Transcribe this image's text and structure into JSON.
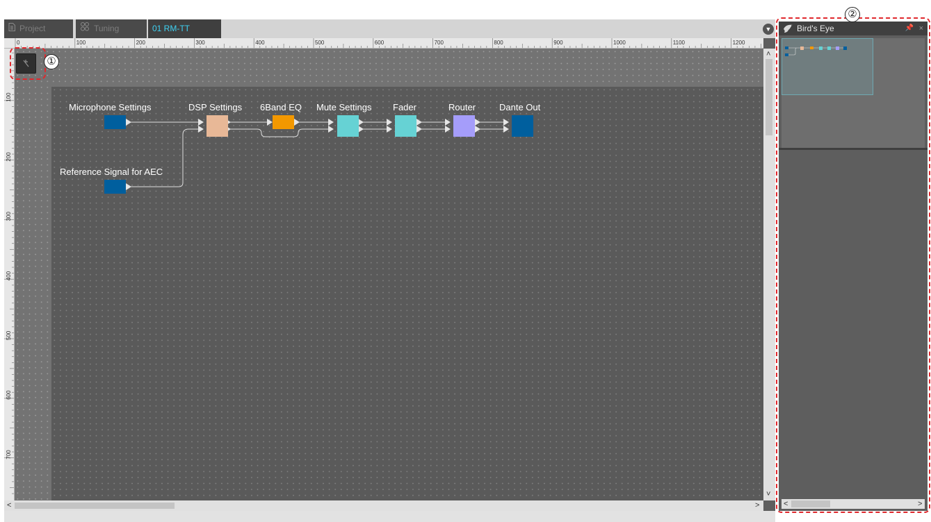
{
  "tabs": [
    {
      "label": "Project",
      "icon": "document-icon"
    },
    {
      "label": "Tuning",
      "icon": "sliders-icon"
    },
    {
      "label": "01 RM-TT",
      "icon": ""
    }
  ],
  "ruler": {
    "top_labels": [
      "0",
      "100",
      "200",
      "300",
      "400",
      "500",
      "600",
      "700",
      "800",
      "900",
      "1000",
      "1100",
      "1200"
    ],
    "left_labels": [
      "100",
      "200",
      "300",
      "400",
      "500",
      "600",
      "700"
    ]
  },
  "blocks": {
    "mic": {
      "label": "Microphone Settings",
      "color": "#005f9e"
    },
    "ref": {
      "label": "Reference Signal for AEC",
      "color": "#005f9e"
    },
    "dsp": {
      "label": "DSP Settings",
      "color": "#e8b897"
    },
    "eq": {
      "label": "6Band EQ",
      "color": "#f39800"
    },
    "mute": {
      "label": "Mute Settings",
      "color": "#66d2d4"
    },
    "fader": {
      "label": "Fader",
      "color": "#66d2d4"
    },
    "router": {
      "label": "Router",
      "color": "#a59dfa"
    },
    "dante": {
      "label": "Dante Out",
      "color": "#005f9e"
    }
  },
  "callouts": {
    "one": "①",
    "two": "②"
  },
  "birdseye": {
    "title": "Bird's Eye"
  },
  "colors": {
    "accent_tab": "#3fd1f2",
    "callout": "#e0282d"
  }
}
